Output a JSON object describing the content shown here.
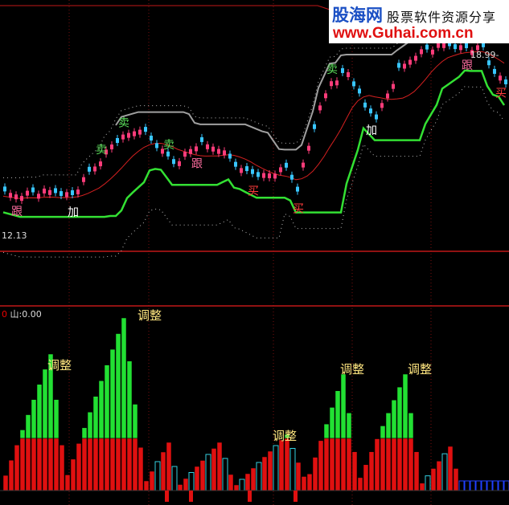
{
  "watermark": {
    "brand": "股海网",
    "tagline": "股票软件资源分享",
    "url": "www.Guhai.com.cn"
  },
  "chart_data": {
    "type": "candlestick",
    "price_low_label": "12.13",
    "price_high_label": "18.99-",
    "colors": {
      "up": "#ff3c7a",
      "down": "#39c6ff",
      "ma": "#d52020",
      "band_upper": "#a0a0a0",
      "band_lower": "#33e033",
      "adjust_green": "#22e033",
      "adjust_red": "#e01010",
      "cyan": "#33d0e0",
      "blue": "#2040ff"
    },
    "indicator": {
      "mark": "0",
      "name": "山",
      "value_text": ":0.00"
    },
    "signals": [
      {
        "text": "跟",
        "i": 2,
        "color": "#ff6ea0"
      },
      {
        "text": "加",
        "i": 12,
        "color": "#fff"
      },
      {
        "text": "卖",
        "i": 17,
        "color": "#5adc5a"
      },
      {
        "text": "卖",
        "i": 21,
        "color": "#5adc5a"
      },
      {
        "text": "卖",
        "i": 29,
        "color": "#5adc5a"
      },
      {
        "text": "跟",
        "i": 34,
        "color": "#ff6ea0"
      },
      {
        "text": "买",
        "i": 44,
        "color": "#ff3c3c"
      },
      {
        "text": "买",
        "i": 52,
        "color": "#ff3c3c"
      },
      {
        "text": "卖",
        "i": 58,
        "color": "#5adc5a"
      },
      {
        "text": "加",
        "i": 65,
        "color": "#fff"
      },
      {
        "text": "跟",
        "i": 82,
        "color": "#ff6ea0"
      },
      {
        "text": "买",
        "i": 88,
        "color": "#ff3c3c"
      }
    ],
    "adjust_labels": [
      {
        "text": "调整",
        "i": 9
      },
      {
        "text": "调整",
        "i": 25
      },
      {
        "text": "调整",
        "i": 49
      },
      {
        "text": "调整",
        "i": 61
      },
      {
        "text": "调整",
        "i": 73
      }
    ]
  }
}
